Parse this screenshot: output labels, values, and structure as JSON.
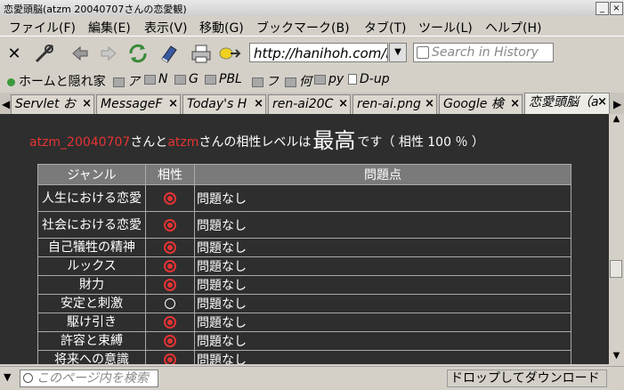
{
  "window": {
    "title": "恋愛頭脳(atzm 20040707さんの恋愛観)"
  },
  "menu": [
    "ファイル(F)",
    "編集(E)",
    "表示(V)",
    "移動(G)",
    "ブックマーク(B)",
    "タブ(T)",
    "ツール(L)",
    "ヘルプ(H)"
  ],
  "nav": {
    "url": "http://hanihoh.com/l",
    "search_placeholder": "Search in History"
  },
  "bookmarks": [
    "ホームと隠れ家",
    "ア",
    "N",
    "G",
    "PBL",
    "フ",
    "何",
    "py",
    "D-up"
  ],
  "tabs": [
    {
      "label": "Servlet お"
    },
    {
      "label": "MessageF"
    },
    {
      "label": "Today's H"
    },
    {
      "label": "ren-ai20C"
    },
    {
      "label": "ren-ai.png"
    },
    {
      "label": "Google 検"
    },
    {
      "label": "恋愛頭脳（a"
    }
  ],
  "tab_close": "×",
  "page": {
    "user1": "atzm_20040707",
    "san_to": "さんと",
    "user2": "atzm",
    "mid": "さんの相性レベルは",
    "level": "最高",
    "suffix": "です（ 相性 100 ％ ）",
    "headers": {
      "genre": "ジャンル",
      "compat": "相性",
      "problem": "問題点"
    },
    "rows": [
      {
        "genre": "人生における恋愛",
        "mark": "double",
        "problem": "問題なし"
      },
      {
        "genre": "社会における恋愛",
        "mark": "double",
        "problem": "問題なし"
      },
      {
        "genre": "自己犠牲の精神",
        "mark": "double",
        "problem": "問題なし"
      },
      {
        "genre": "ルックス",
        "mark": "double",
        "problem": "問題なし"
      },
      {
        "genre": "財力",
        "mark": "double",
        "problem": "問題なし"
      },
      {
        "genre": "安定と刺激",
        "mark": "single",
        "problem": "問題なし"
      },
      {
        "genre": "駆け引き",
        "mark": "double",
        "problem": "問題なし"
      },
      {
        "genre": "許容と束縛",
        "mark": "double",
        "problem": "問題なし"
      },
      {
        "genre": "将来への意識",
        "mark": "double",
        "problem": "問題なし"
      }
    ]
  },
  "status": {
    "find_placeholder": "このページ内を検索",
    "message": "ドロップしてダウンロード"
  }
}
